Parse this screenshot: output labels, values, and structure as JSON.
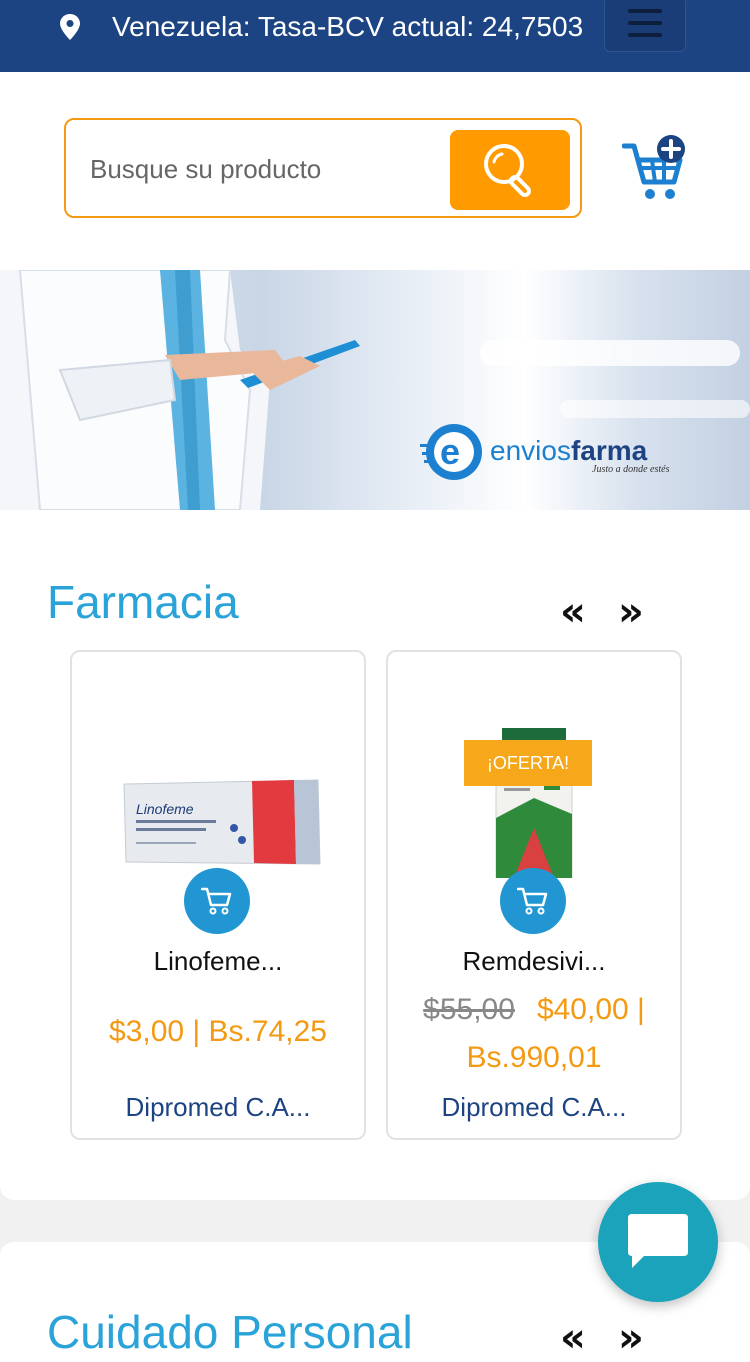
{
  "topbar": {
    "rate_text": "Venezuela: Tasa-BCV actual: 24,7503"
  },
  "search": {
    "placeholder": "Busque su producto"
  },
  "banner": {
    "brand": "enviosfarma",
    "brand_prefix": "envios",
    "brand_suffix": "farma",
    "tagline": "Justo a donde estés"
  },
  "sections": [
    {
      "title": "Farmacia",
      "prev": "«",
      "next": "»",
      "products": [
        {
          "name": "Linofeme...",
          "price": "$3,00 | Bs.74,25",
          "seller": "Dipromed C.A...",
          "box_brand": "Linofeme"
        },
        {
          "name": "Remdesivi...",
          "badge": "¡OFERTA!",
          "old_price": "$55,00",
          "price": "$40,00 | Bs.990,01",
          "seller": "Dipromed C.A..."
        }
      ]
    },
    {
      "title": "Cuidado Personal",
      "prev": "«",
      "next": "»"
    }
  ],
  "colors": {
    "topbar": "#1c4382",
    "accent_orange": "#ff9a00",
    "title_blue": "#29a3d8",
    "cart_blue": "#2196d3",
    "chat_teal": "#1aa3bb"
  },
  "icons": [
    "location-pin-icon",
    "hamburger-menu-icon",
    "search-icon",
    "cart-add-icon",
    "cart-icon",
    "chat-icon"
  ]
}
